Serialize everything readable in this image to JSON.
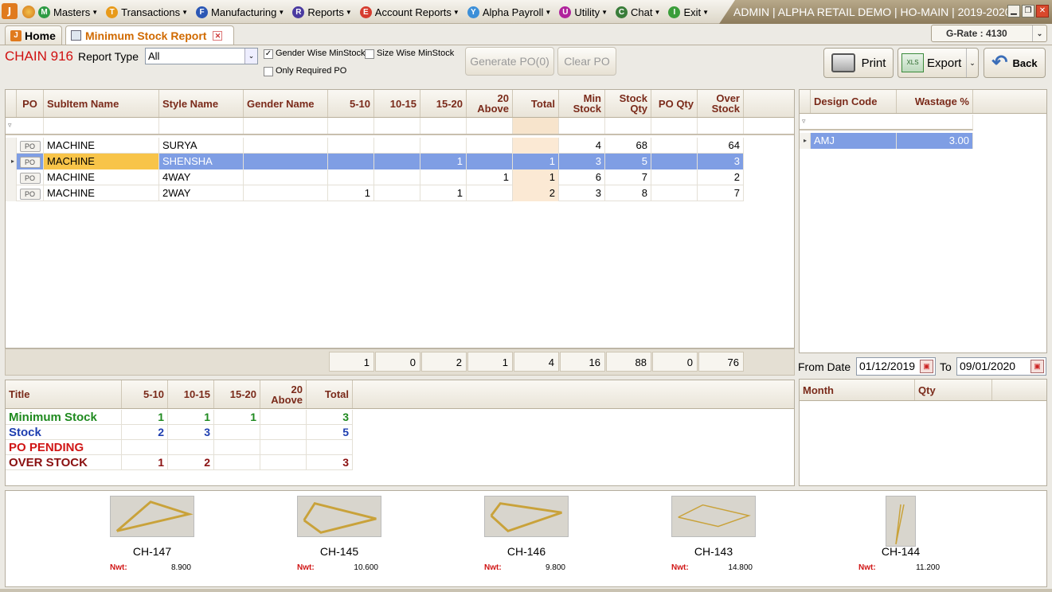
{
  "app": {
    "logo_letter": "J",
    "window_title": "ADMIN | ALPHA RETAIL DEMO | HO-MAIN | 2019-2020",
    "menus": [
      {
        "icon": "M",
        "label": "Masters",
        "color": "#2e9b44"
      },
      {
        "icon": "T",
        "label": "Transactions",
        "color": "#e89a1a"
      },
      {
        "icon": "F",
        "label": "Manufacturing",
        "color": "#2b57b5"
      },
      {
        "icon": "R",
        "label": "Reports",
        "color": "#4a3aa0"
      },
      {
        "icon": "E",
        "label": "Account Reports",
        "color": "#d63c2e"
      },
      {
        "icon": "Y",
        "label": "Alpha Payroll",
        "color": "#3c8fd8"
      },
      {
        "icon": "U",
        "label": "Utility",
        "color": "#b0239c"
      },
      {
        "icon": "C",
        "label": "Chat",
        "color": "#3a7d3a"
      },
      {
        "icon": "I",
        "label": "Exit",
        "color": "#3a9d3a"
      }
    ]
  },
  "tabs": {
    "home": "Home",
    "report": "Minimum Stock Report"
  },
  "grate": "G-Rate : 4130",
  "filters": {
    "item_name": "CHAIN 916",
    "report_type_label": "Report Type",
    "report_type_value": "All",
    "gender_wise_label": "Gender Wise MinStock",
    "gender_wise_checked": true,
    "size_wise_label": "Size Wise MinStock",
    "size_wise_checked": false,
    "only_required_label": "Only Required PO",
    "only_required_checked": false
  },
  "buttons": {
    "generate_po": "Generate PO(0)",
    "clear_po": "Clear PO",
    "print": "Print",
    "export": "Export",
    "back": "Back"
  },
  "main_grid": {
    "columns": [
      "PO",
      "SubItem Name",
      "Style Name",
      "Gender Name",
      "5-10",
      "10-15",
      "15-20",
      "20 Above",
      "Total",
      "Min Stock",
      "Stock Qty",
      "PO Qty",
      "Over Stock"
    ],
    "rows": [
      {
        "po": "PO",
        "subitem": "MACHINE",
        "style": "SURYA",
        "gender": "",
        "c510": "",
        "c1015": "",
        "c1520": "",
        "c20": "",
        "total": "",
        "min": "4",
        "stock": "68",
        "poqty": "",
        "over": "64"
      },
      {
        "po": "PO",
        "subitem": "MACHINE",
        "style": "SHENSHA",
        "gender": "",
        "c510": "",
        "c1015": "",
        "c1520": "1",
        "c20": "",
        "total": "1",
        "min": "3",
        "stock": "5",
        "poqty": "",
        "over": "3"
      },
      {
        "po": "PO",
        "subitem": "MACHINE",
        "style": "4WAY",
        "gender": "",
        "c510": "",
        "c1015": "",
        "c1520": "",
        "c20": "1",
        "total": "1",
        "min": "6",
        "stock": "7",
        "poqty": "",
        "over": "2"
      },
      {
        "po": "PO",
        "subitem": "MACHINE",
        "style": "2WAY",
        "gender": "",
        "c510": "1",
        "c1015": "",
        "c1520": "1",
        "c20": "",
        "total": "2",
        "min": "3",
        "stock": "8",
        "poqty": "",
        "over": "7"
      }
    ],
    "totals": [
      "1",
      "0",
      "2",
      "1",
      "4",
      "16",
      "88",
      "0",
      "76"
    ]
  },
  "design_grid": {
    "columns": [
      "Design Code",
      "Wastage %"
    ],
    "rows": [
      {
        "code": "AMJ",
        "wastage": "3.00"
      }
    ]
  },
  "date_range": {
    "from_label": "From Date",
    "from": "01/12/2019",
    "to_label": "To",
    "to": "09/01/2020"
  },
  "month_grid": {
    "columns": [
      "Month",
      "Qty"
    ]
  },
  "summary_grid": {
    "columns": [
      "Title",
      "5-10",
      "10-15",
      "15-20",
      "20 Above",
      "Total"
    ],
    "rows": [
      {
        "title": "Minimum Stock",
        "color": "#1f8a1f",
        "c510": "1",
        "c1015": "1",
        "c1520": "1",
        "c20": "",
        "total": "3"
      },
      {
        "title": "Stock",
        "color": "#1f3fb0",
        "c510": "2",
        "c1015": "3",
        "c1520": "",
        "c20": "",
        "total": "5"
      },
      {
        "title": "PO PENDING",
        "color": "#d01515",
        "c510": "",
        "c1015": "",
        "c1520": "",
        "c20": "",
        "total": ""
      },
      {
        "title": "OVER STOCK",
        "color": "#8a1010",
        "c510": "1",
        "c1015": "2",
        "c1520": "",
        "c20": "",
        "total": "3"
      }
    ]
  },
  "gallery": {
    "nwt_label": "Nwt:",
    "items": [
      {
        "code": "CH-147",
        "nwt": "8.900"
      },
      {
        "code": "CH-145",
        "nwt": "10.600"
      },
      {
        "code": "CH-146",
        "nwt": "9.800"
      },
      {
        "code": "CH-143",
        "nwt": "14.800"
      },
      {
        "code": "CH-144",
        "nwt": "11.200"
      }
    ]
  }
}
